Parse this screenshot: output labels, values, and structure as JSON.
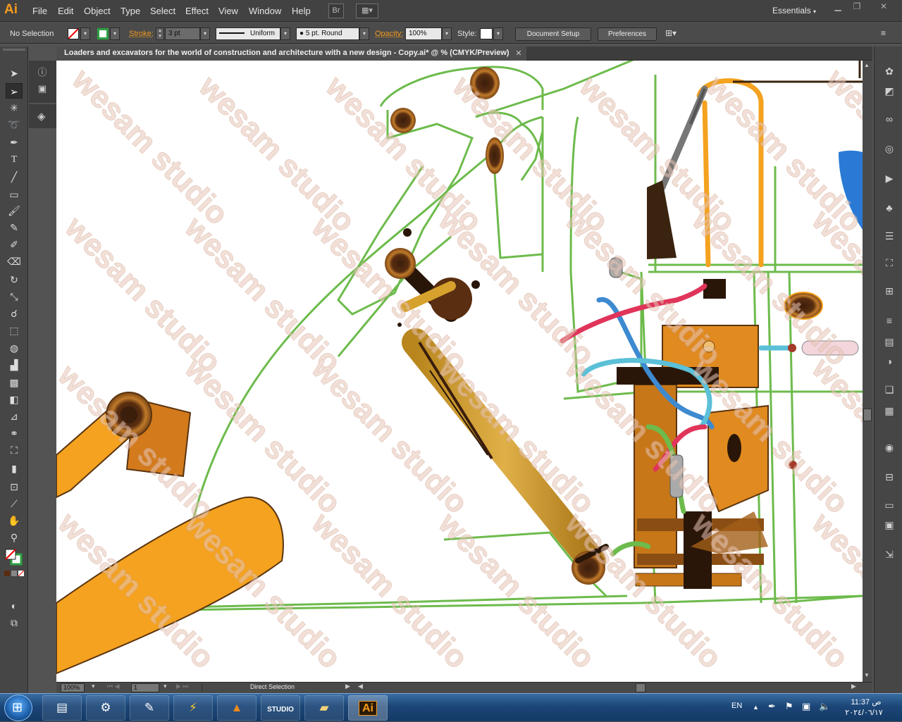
{
  "app": {
    "logo": "Ai"
  },
  "menu": [
    "File",
    "Edit",
    "Object",
    "Type",
    "Select",
    "Effect",
    "View",
    "Window",
    "Help"
  ],
  "bridge_button": "Br",
  "workspace": "Essentials",
  "control": {
    "selection_status": "No Selection",
    "stroke_label": "Stroke:",
    "stroke_weight": "3 pt",
    "profile": "Uniform",
    "brush": "5 pt. Round",
    "opacity_label": "Opacity:",
    "opacity": "100%",
    "style_label": "Style:",
    "document_setup": "Document Setup",
    "preferences": "Preferences"
  },
  "document": {
    "tab_title": "Loaders and excavators for the world of construction and architecture with a new design - Copy.ai* @ % (CMYK/Preview)"
  },
  "watermark": "wesam studio",
  "status": {
    "zoom": "100%",
    "artboard": "1",
    "tool": "Direct Selection"
  },
  "tools": [
    "selection-tool",
    "direct-selection-tool",
    "magic-wand-tool",
    "lasso-tool",
    "pen-tool",
    "type-tool",
    "line-segment-tool",
    "rectangle-tool",
    "paintbrush-tool",
    "pencil-tool",
    "blob-brush-tool",
    "eraser-tool",
    "rotate-tool",
    "scale-tool",
    "warp-tool",
    "free-transform-tool",
    "shape-builder-tool",
    "perspective-grid-tool",
    "mesh-tool",
    "gradient-tool",
    "eyedropper-tool",
    "blend-tool",
    "symbol-sprayer-tool",
    "column-graph-tool",
    "artboard-tool",
    "slice-tool",
    "hand-tool",
    "zoom-tool"
  ],
  "taskbar": {
    "language": "EN",
    "time": "11:37 ص",
    "date": "٢٠٢٤/٠٦/١٧",
    "apps": [
      "task-manager",
      "system-tool",
      "pen-tablet",
      "winamp",
      "vlc",
      "studio",
      "file-explorer",
      "illustrator"
    ]
  },
  "colors": {
    "accent": "#f39a1d",
    "machine_green": "#6dbb4c",
    "hydraulic_gold": "#d6a12c",
    "bucket_orange": "#f4a21f"
  }
}
